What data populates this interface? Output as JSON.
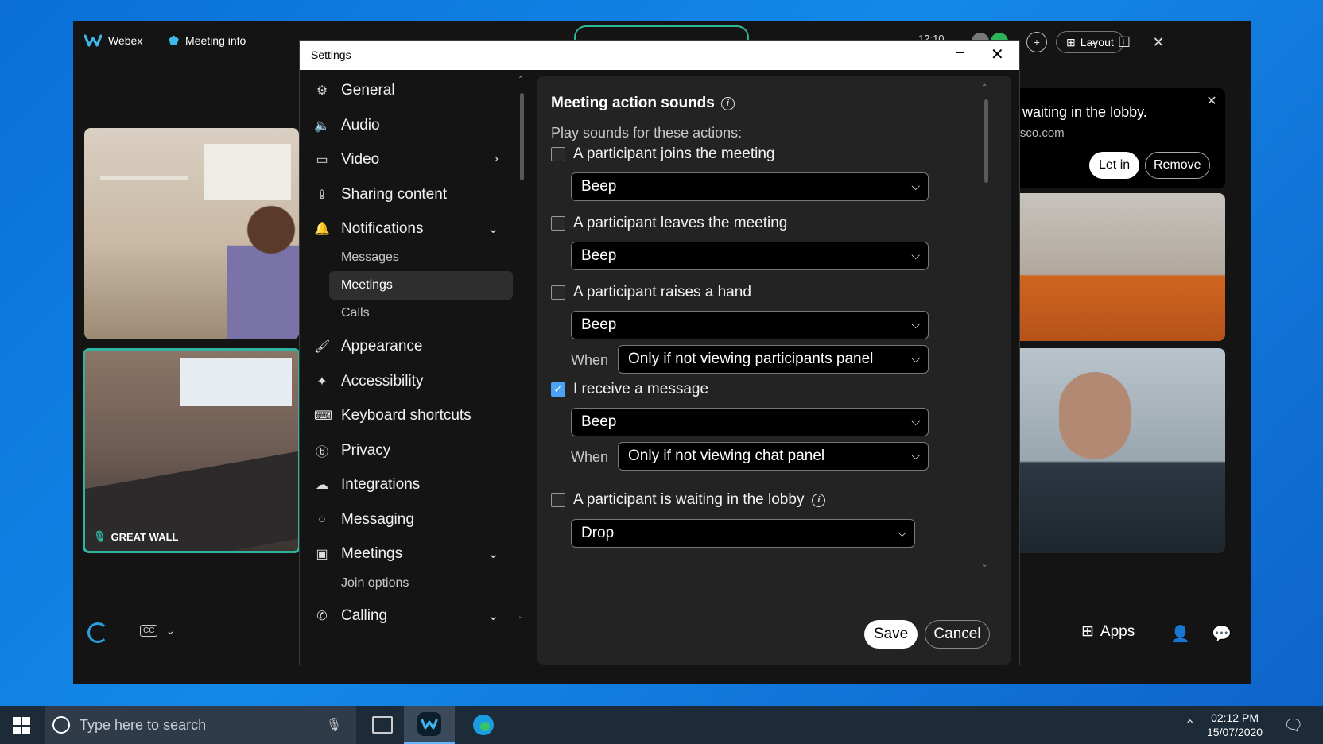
{
  "webex": {
    "app_name": "Webex",
    "meeting_info": "Meeting info",
    "time": "12:10",
    "layout_label": "Layout",
    "tile_label": "GREAT WALL",
    "lobby": {
      "message": "s waiting in the lobby.",
      "email": "cisco.com",
      "let_in": "Let in",
      "remove": "Remove"
    },
    "apps_label": "Apps"
  },
  "settings": {
    "title": "Settings",
    "nav": [
      {
        "label": "General",
        "icon": "gear-icon"
      },
      {
        "label": "Audio",
        "icon": "speaker-icon"
      },
      {
        "label": "Video",
        "icon": "video-icon"
      },
      {
        "label": "Sharing content",
        "icon": "share-icon"
      },
      {
        "label": "Notifications",
        "icon": "bell-icon"
      },
      {
        "label": "Appearance",
        "icon": "paint-icon"
      },
      {
        "label": "Accessibility",
        "icon": "accessibility-icon"
      },
      {
        "label": "Keyboard shortcuts",
        "icon": "keyboard-icon"
      },
      {
        "label": "Privacy",
        "icon": "privacy-icon"
      },
      {
        "label": "Integrations",
        "icon": "cloud-icon"
      },
      {
        "label": "Messaging",
        "icon": "chat-icon"
      },
      {
        "label": "Meetings",
        "icon": "calendar-icon"
      },
      {
        "label": "Calling",
        "icon": "phone-icon"
      }
    ],
    "notifications_sub": [
      "Messages",
      "Meetings",
      "Calls"
    ],
    "meetings_sub": [
      "Join options"
    ],
    "section_title": "Meeting action sounds",
    "section_sub": "Play sounds for these actions:",
    "actions": [
      {
        "label": "A participant joins the meeting",
        "checked": false,
        "sound": "Beep"
      },
      {
        "label": "A participant leaves the meeting",
        "checked": false,
        "sound": "Beep"
      },
      {
        "label": "A participant raises a hand",
        "checked": false,
        "sound": "Beep",
        "when": "Only if not viewing participants panel"
      },
      {
        "label": "I receive a message",
        "checked": true,
        "sound": "Beep",
        "when": "Only if not viewing chat panel"
      },
      {
        "label": "A participant is waiting in the lobby",
        "checked": false,
        "sound": "Drop"
      }
    ],
    "when_label": "When",
    "save": "Save",
    "cancel": "Cancel"
  },
  "taskbar": {
    "search_placeholder": "Type here to search",
    "time": "02:12 PM",
    "date": "15/07/2020"
  },
  "colors": {
    "accent": "#4ba3f5",
    "teal": "#2db3a0",
    "desktop": "#0a6fd8"
  }
}
